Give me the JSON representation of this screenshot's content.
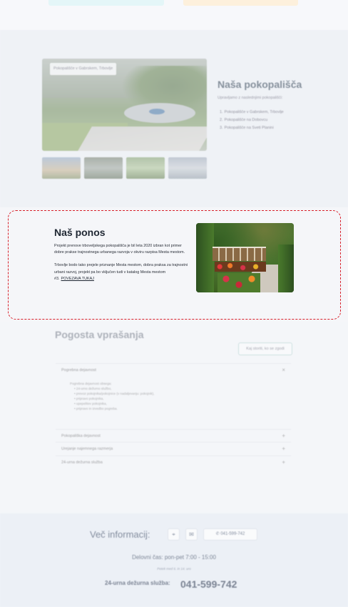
{
  "cemeteries": {
    "badge": "Pokopališče v Gabrskem, Trbovlje",
    "title": "Naša pokopališča",
    "subtitle": "Upravljamo z naslednjimi pokopališči:",
    "list": [
      {
        "n": "1.",
        "label": "Pokopališče v Gabrskem, Trbovlje"
      },
      {
        "n": "2.",
        "label": "Pokopališče na Dobovcu"
      },
      {
        "n": "3.",
        "label": "Pokopališče na Sveti Planini"
      }
    ]
  },
  "pledge": {
    "title": "Naš ponos",
    "paragraph1": "Projekt prenove trboveljskega pokopališča je bil leta 2020 izbran kot primer dobre prakse trajnostnega urbanega razvoja v okviru razpisa Mesta mestom.",
    "paragraph2": "Trbovlje bodo tako prejele priznanje Mesta mestom, dobra praksa za trajnostni urbani razvoj, projekt pa bo vključen tudi v katalog Mesta mestom #3.",
    "link_label": "POVEZAVA TUKAJ"
  },
  "faq": {
    "title": "Pogosta vprašanja",
    "button_label": "Kaj storiti, ko se zgodi",
    "open_item": {
      "question": "Pogrebna dejavnost",
      "toggle": "×",
      "answer_intro": "Pogrebna dejavnost obsega:",
      "answer_points": [
        "24-urno dežurno službo,",
        "prevoz pokojnika/pokojnice (v nadaljevanju: pokojnik),",
        "pripravo pokojnika,",
        "upepelitev pokojnika,",
        "pripravo in izvedbo pogreba."
      ]
    },
    "closed_items": [
      {
        "question": "Pokopališka dejavnost",
        "toggle": "+"
      },
      {
        "question": "Urejanje najemnega razmerja",
        "toggle": "+"
      },
      {
        "question": "24-urna dežurna služba",
        "toggle": "+"
      }
    ]
  },
  "footer": {
    "more_info": "Več informacij:",
    "location_icon": "⌖",
    "mail_icon": "✉",
    "phone_icon": "✆",
    "phone": "041-599-742",
    "hours": "Delovni čas: pon-pet 7:00 - 15:00",
    "hours_note": "Petek med 6. in 14. uro",
    "emergency_label": "24-urna dežurna služba:",
    "emergency_number": "041-599-742"
  }
}
